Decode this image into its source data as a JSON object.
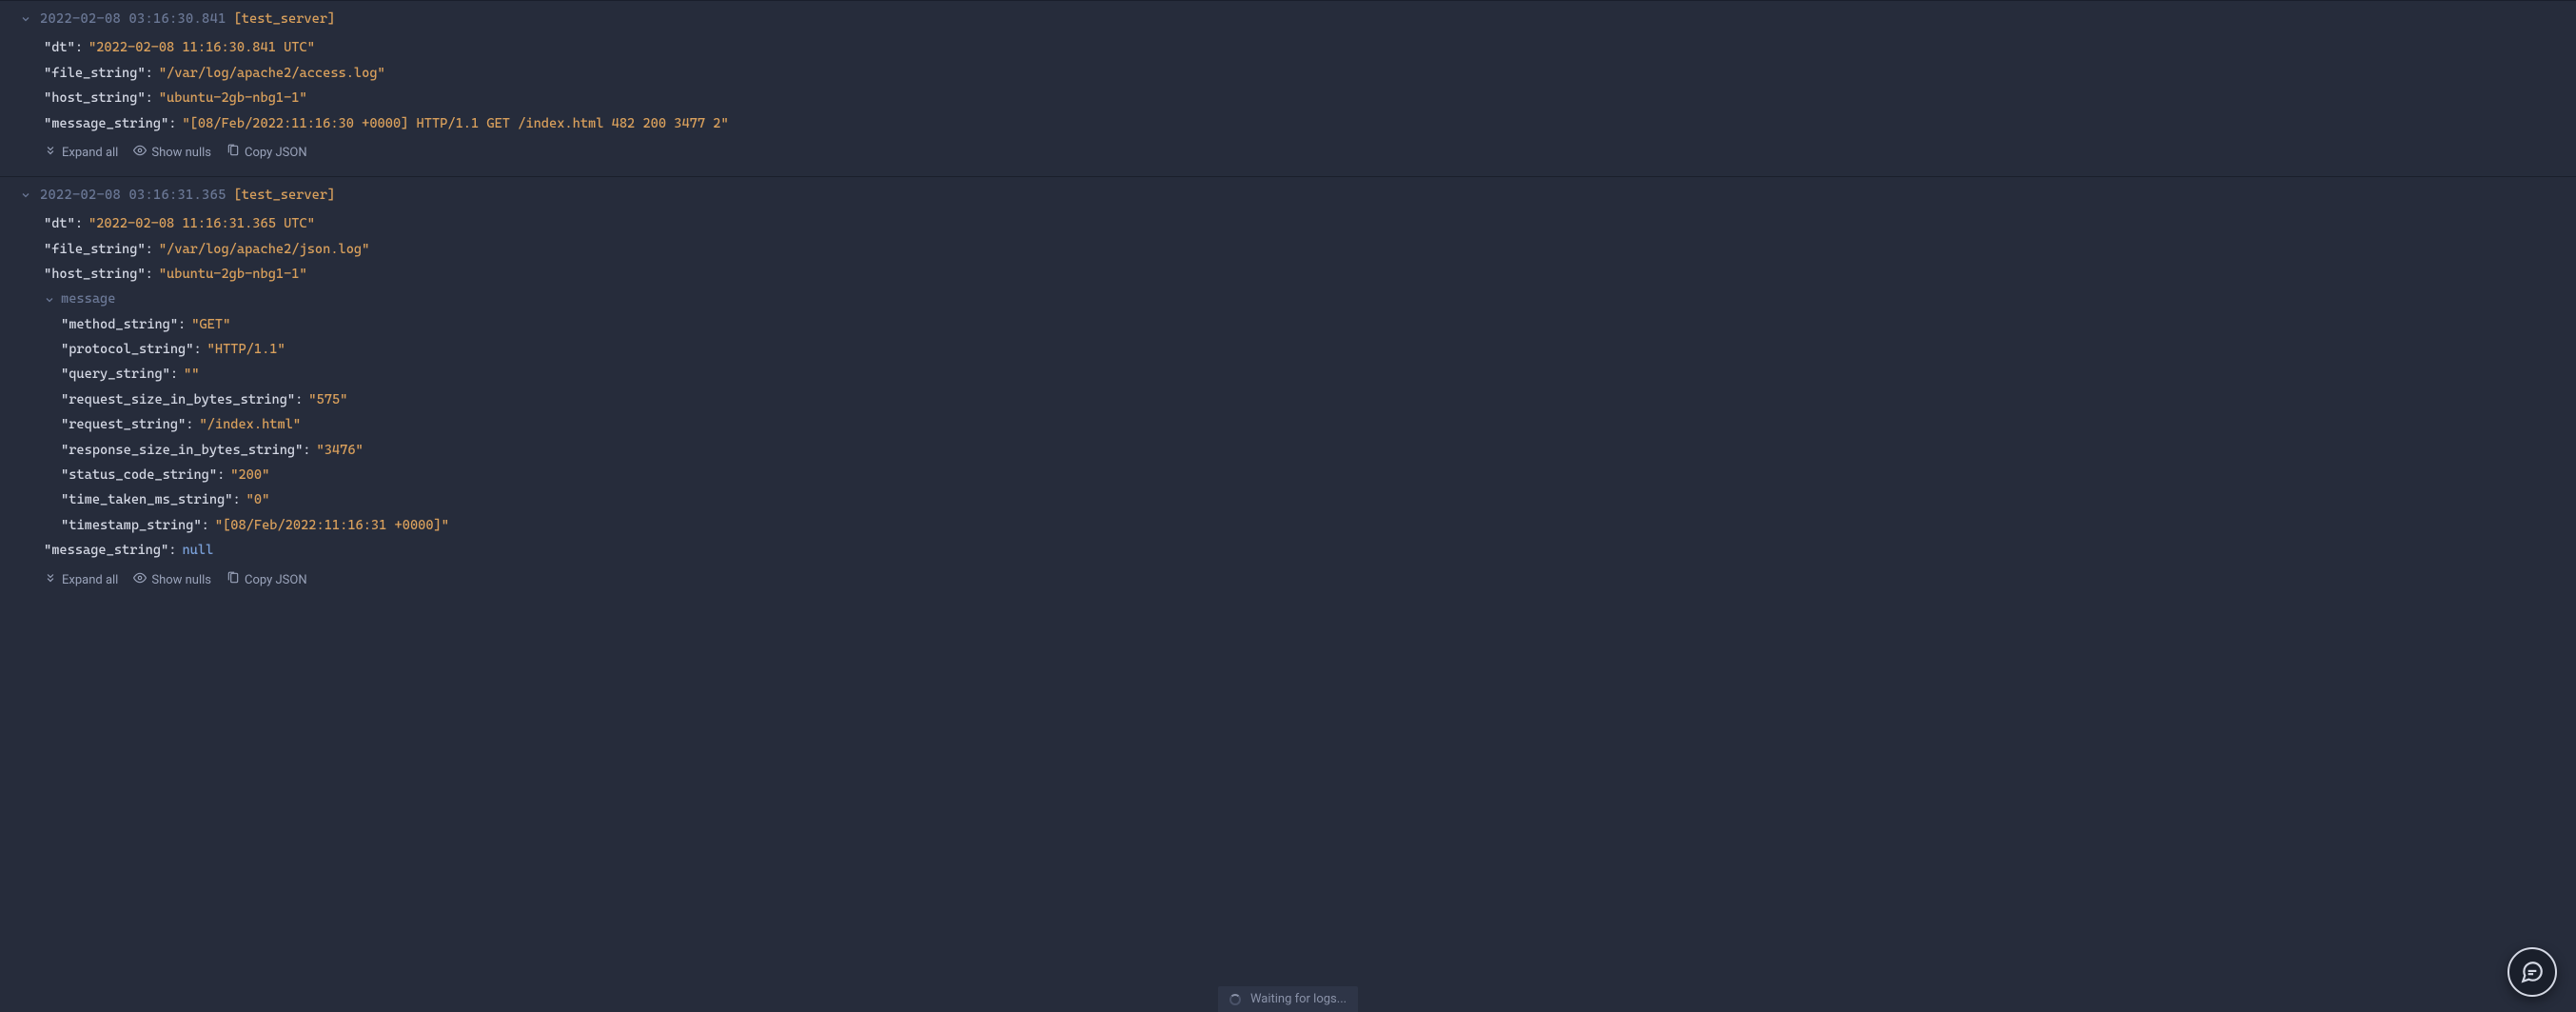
{
  "entries": [
    {
      "timestamp": "2022-02-08 03:16:30.841",
      "source": "[test_server]",
      "fields": [
        {
          "key": "\"dt\"",
          "value": "\"2022-02-08 11:16:30.841 UTC\"",
          "type": "str"
        },
        {
          "key": "\"file_string\"",
          "value": "\"/var/log/apache2/access.log\"",
          "type": "str"
        },
        {
          "key": "\"host_string\"",
          "value": "\"ubuntu-2gb-nbg1-1\"",
          "type": "str"
        },
        {
          "key": "\"message_string\"",
          "value": "\"[08/Feb/2022:11:16:30 +0000] HTTP/1.1 GET /index.html 482 200 3477 2\"",
          "type": "str"
        }
      ]
    },
    {
      "timestamp": "2022-02-08 03:16:31.365",
      "source": "[test_server]",
      "fields": [
        {
          "key": "\"dt\"",
          "value": "\"2022-02-08 11:16:31.365 UTC\"",
          "type": "str"
        },
        {
          "key": "\"file_string\"",
          "value": "\"/var/log/apache2/json.log\"",
          "type": "str"
        },
        {
          "key": "\"host_string\"",
          "value": "\"ubuntu-2gb-nbg1-1\"",
          "type": "str"
        }
      ],
      "nested": {
        "label": "message",
        "fields": [
          {
            "key": "\"method_string\"",
            "value": "\"GET\"",
            "type": "str"
          },
          {
            "key": "\"protocol_string\"",
            "value": "\"HTTP/1.1\"",
            "type": "str"
          },
          {
            "key": "\"query_string\"",
            "value": "\"\"",
            "type": "str"
          },
          {
            "key": "\"request_size_in_bytes_string\"",
            "value": "\"575\"",
            "type": "str"
          },
          {
            "key": "\"request_string\"",
            "value": "\"/index.html\"",
            "type": "str"
          },
          {
            "key": "\"response_size_in_bytes_string\"",
            "value": "\"3476\"",
            "type": "str"
          },
          {
            "key": "\"status_code_string\"",
            "value": "\"200\"",
            "type": "str"
          },
          {
            "key": "\"time_taken_ms_string\"",
            "value": "\"0\"",
            "type": "str"
          },
          {
            "key": "\"timestamp_string\"",
            "value": "\"[08/Feb/2022:11:16:31 +0000]\"",
            "type": "str"
          }
        ]
      },
      "trailing": [
        {
          "key": "\"message_string\"",
          "value": "null",
          "type": "null"
        }
      ]
    }
  ],
  "actions": {
    "expand": "Expand all",
    "show_nulls": "Show nulls",
    "copy_json": "Copy JSON"
  },
  "status": "Waiting for logs..."
}
